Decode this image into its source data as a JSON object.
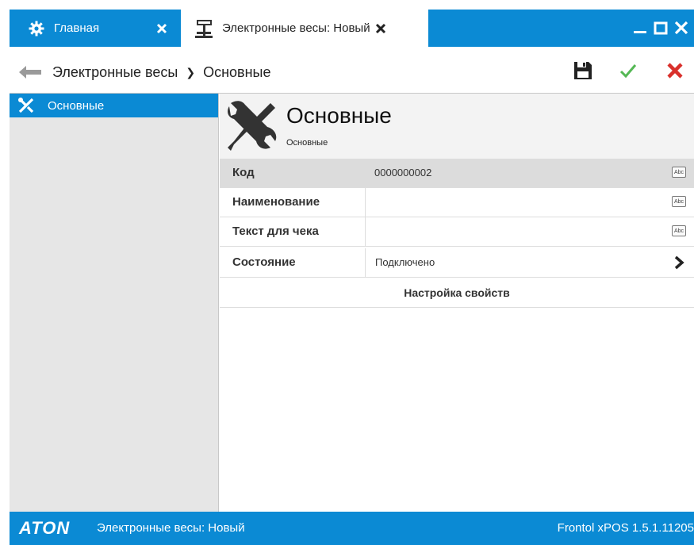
{
  "colors": {
    "accent": "#0b8ad4",
    "save_check": "#55b855",
    "cancel_x": "#d9302c",
    "sidebar_bg": "#e6e6e6"
  },
  "tabs": [
    {
      "label": "Главная",
      "icon": "gear-icon",
      "active": false
    },
    {
      "label": "Электронные весы: Новый",
      "icon": "scales-icon",
      "active": true
    }
  ],
  "window_controls": [
    "minimize-icon",
    "maximize-icon",
    "close-icon"
  ],
  "toolbar": {
    "breadcrumb": [
      "Электронные весы",
      "Основные"
    ],
    "buttons": [
      "save-icon",
      "check-icon",
      "cancel-icon"
    ]
  },
  "sidebar": {
    "items": [
      {
        "label": "Основные",
        "icon": "tools-icon",
        "selected": true
      }
    ]
  },
  "main": {
    "title": "Основные",
    "subtitle": "Основные",
    "rows": [
      {
        "label": "Код",
        "value": "0000000002",
        "control": "Abc"
      },
      {
        "label": "Наименование",
        "value": "",
        "control": "Abc"
      },
      {
        "label": "Текст для чека",
        "value": "",
        "control": "Abc"
      },
      {
        "label": "Состояние",
        "value": "Подключено",
        "control": "chevron-right-icon"
      }
    ],
    "settings_button": "Настройка свойств"
  },
  "statusbar": {
    "logo": "ATON",
    "text": "Электронные весы: Новый",
    "version": "Frontol xPOS 1.5.1.11205"
  }
}
